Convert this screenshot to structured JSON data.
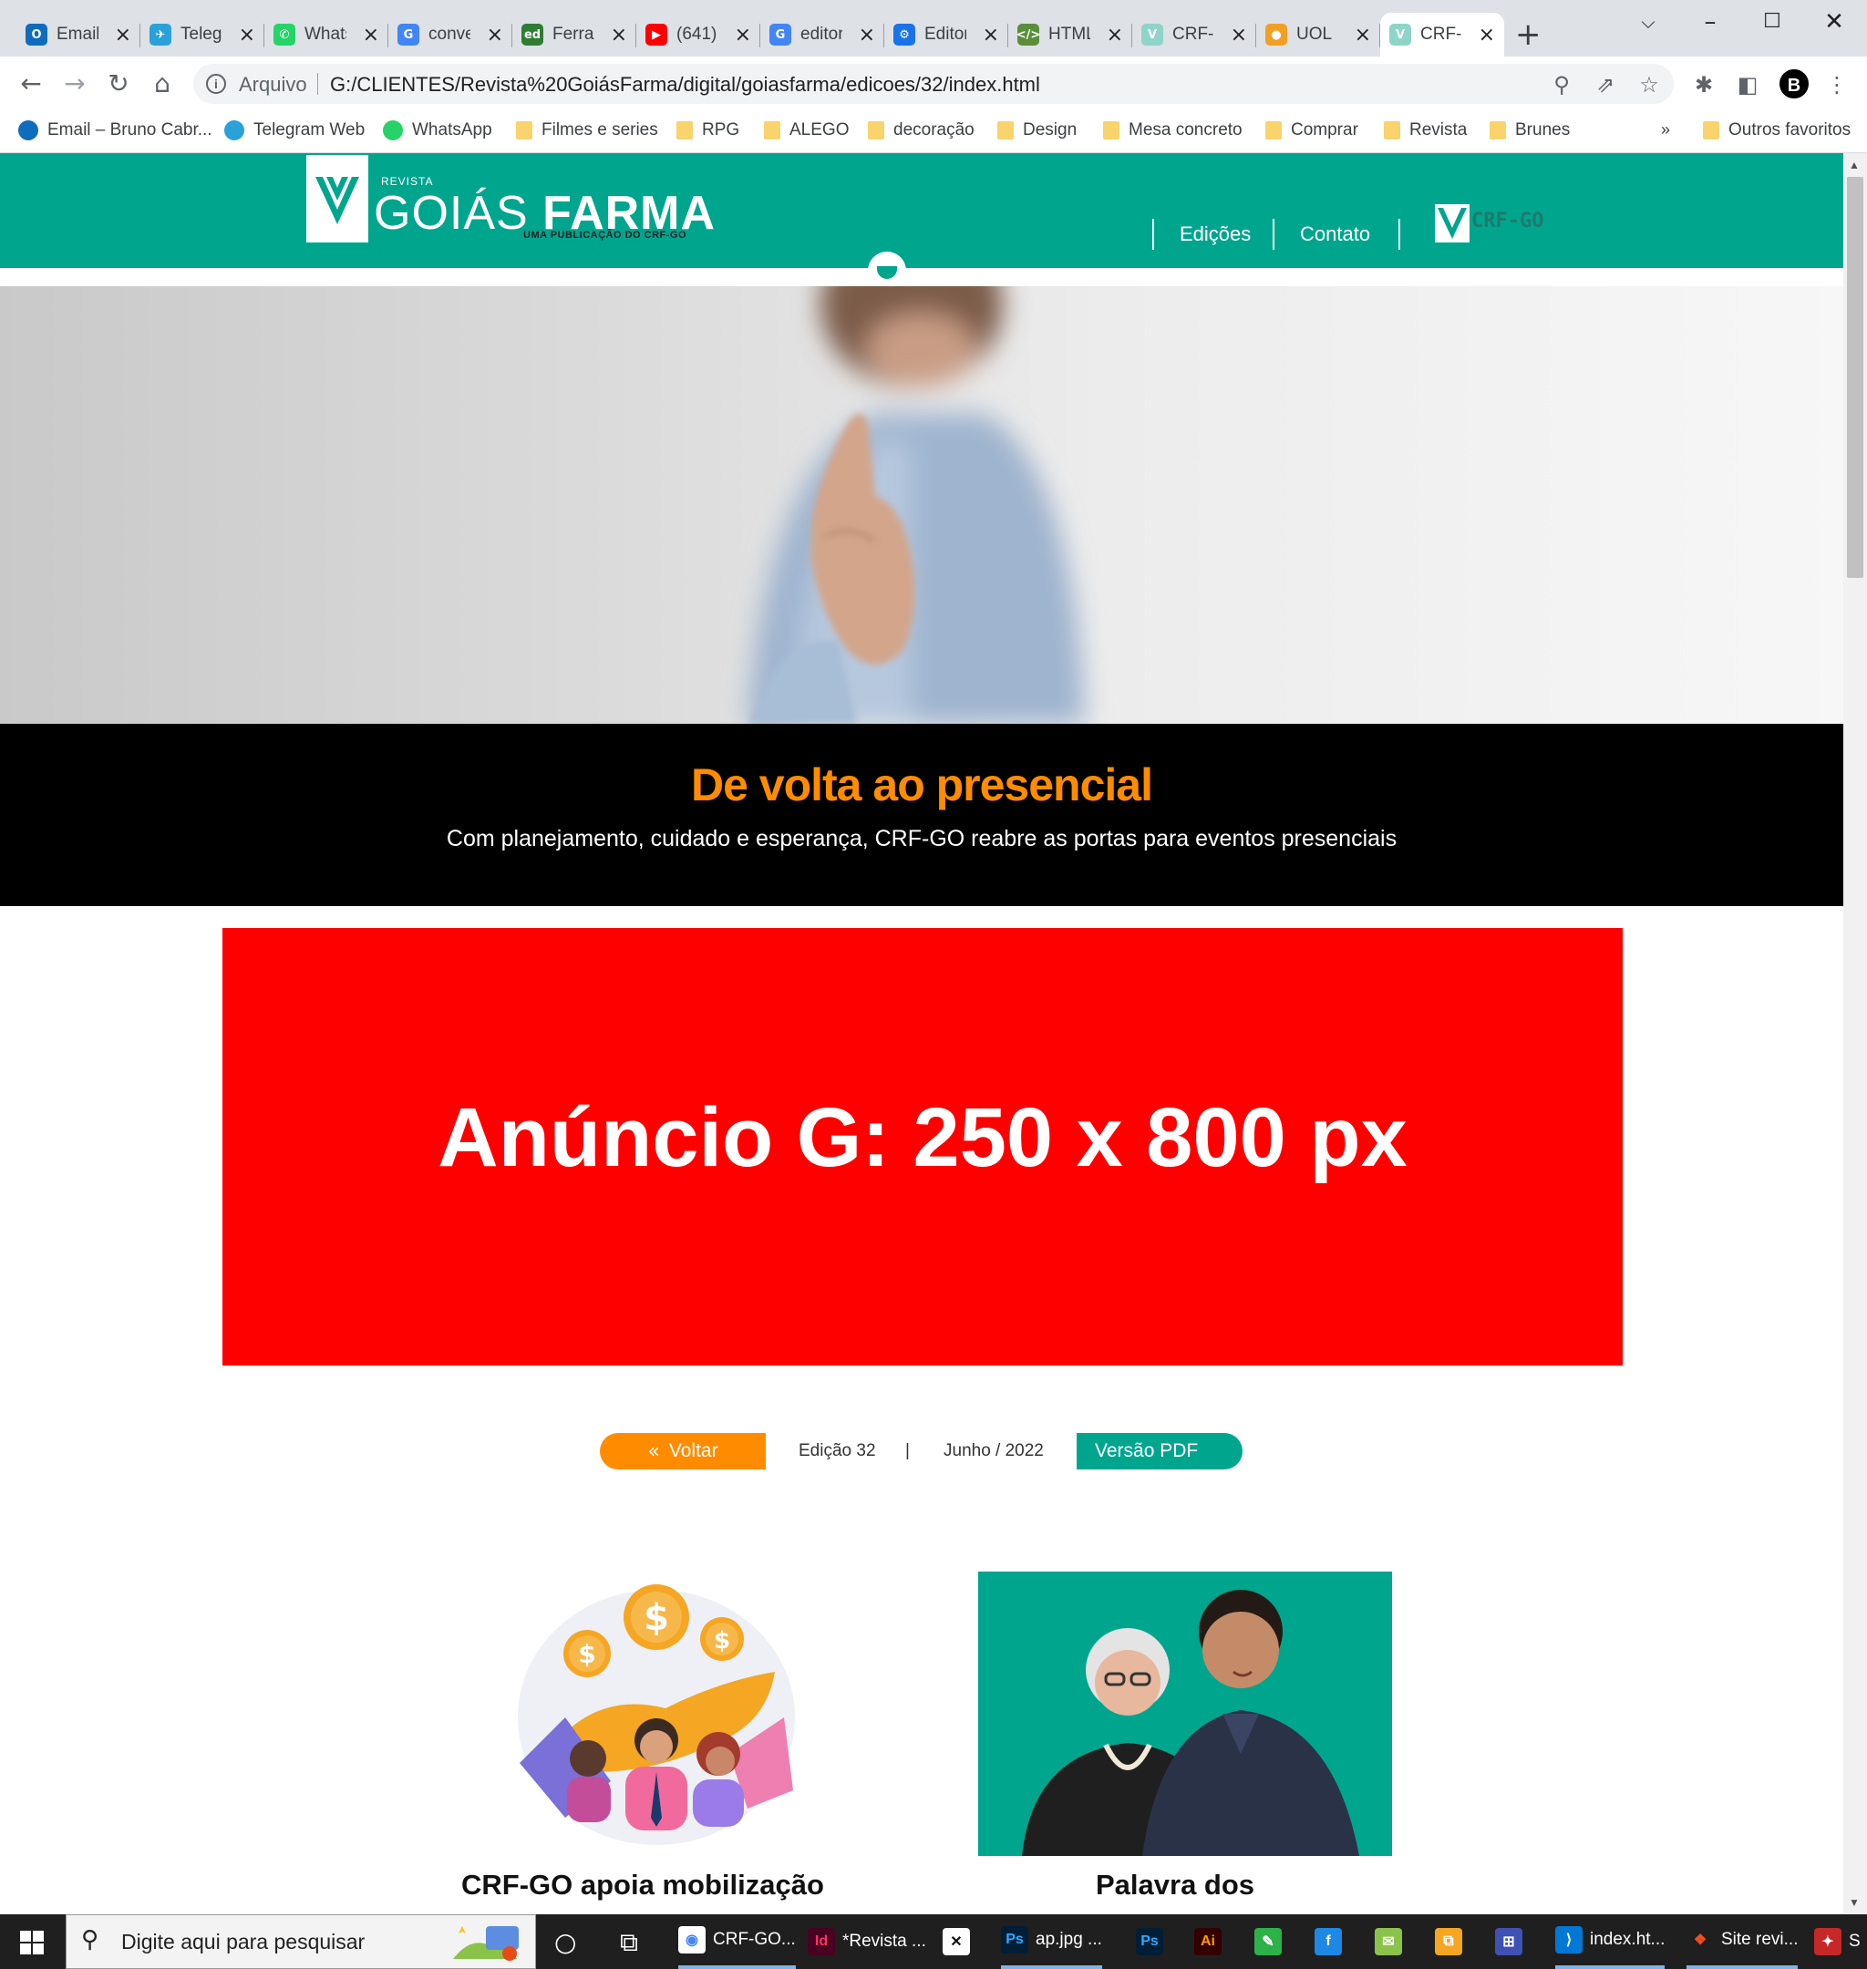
{
  "browser": {
    "tabs": [
      {
        "title": "Email – Bruno Cabral – Outlook",
        "icon": "outlook-icon",
        "color": "#0f6cbd",
        "letter": "O"
      },
      {
        "title": "Telegram Web",
        "icon": "telegram-icon",
        "color": "#2aa1db",
        "letter": "✈"
      },
      {
        "title": "WhatsApp",
        "icon": "whatsapp-icon",
        "color": "#25d366",
        "letter": "✆"
      },
      {
        "title": "conversor",
        "icon": "google-icon",
        "color": "#4285f4",
        "letter": "G"
      },
      {
        "title": "Ferramentas",
        "icon": "edit-icon",
        "color": "#2e7d32",
        "letter": "ed"
      },
      {
        "title": "(641)",
        "icon": "youtube-icon",
        "color": "#ff0000",
        "letter": "▶"
      },
      {
        "title": "editor",
        "icon": "google-icon",
        "color": "#4285f4",
        "letter": "G"
      },
      {
        "title": "Editor",
        "icon": "gear-icon",
        "color": "#1a73e8",
        "letter": "⚙"
      },
      {
        "title": "HTML",
        "icon": "code-icon",
        "color": "#5a8f3a",
        "letter": "</>"
      },
      {
        "title": "CRF-GO",
        "icon": "crf-icon",
        "color": "#8fd4c8",
        "letter": "V"
      },
      {
        "title": "UOL",
        "icon": "uol-icon",
        "color": "#f2a024",
        "letter": "●"
      },
      {
        "title": "CRF-GO",
        "icon": "crf-icon",
        "color": "#8fd4c8",
        "letter": "V"
      }
    ],
    "omnibox": {
      "scheme": "Arquivo",
      "url": "G:/CLIENTES/Revista%20GoiásFarma/digital/goiasfarma/edicoes/32/index.html"
    },
    "profile_letter": "B",
    "bookmarks": [
      {
        "label": "Email – Bruno Cabr...",
        "icon": "outlook-icon",
        "color": "#0f6cbd"
      },
      {
        "label": "Telegram Web",
        "icon": "telegram-icon",
        "color": "#2aa1db"
      },
      {
        "label": "WhatsApp",
        "icon": "whatsapp-icon",
        "color": "#25d366"
      },
      {
        "label": "Filmes e series",
        "icon": "folder-icon"
      },
      {
        "label": "RPG",
        "icon": "folder-icon"
      },
      {
        "label": "ALEGO",
        "icon": "folder-icon"
      },
      {
        "label": "decoração",
        "icon": "folder-icon"
      },
      {
        "label": "Design",
        "icon": "folder-icon"
      },
      {
        "label": "Mesa concreto",
        "icon": "folder-icon"
      },
      {
        "label": "Comprar",
        "icon": "folder-icon"
      },
      {
        "label": "Revista",
        "icon": "folder-icon"
      },
      {
        "label": "Brunes",
        "icon": "folder-icon"
      }
    ],
    "bookmarks_overflow": "»",
    "other_bookmarks": "Outros favoritos"
  },
  "site": {
    "logo": {
      "small": "REVISTA",
      "name_light": "GOIÁS",
      "name_bold": "FARMA",
      "sub": "UMA PUBLICAÇÃO DO CRF-GO"
    },
    "nav": [
      "Edições",
      "Contato"
    ],
    "crf_logo_text": "CRF-GO",
    "article": {
      "title": "De volta ao presencial",
      "subtitle": "Com planejamento, cuidado e esperança, CRF-GO reabre as portas para eventos presenciais"
    },
    "ad_label": "Anúncio G: 250 x 800 px",
    "meta": {
      "back_label": "Voltar",
      "edition": "Edição 32",
      "separator": "|",
      "date": "Junho / 2022",
      "pdf_label": "Versão PDF"
    },
    "cards": [
      {
        "title": "CRF-GO apoia mobilização"
      },
      {
        "title": "Palavra dos"
      }
    ],
    "colors": {
      "brand_green": "#00a58e",
      "accent_orange": "#ff8c00",
      "ad_red": "#ff0000"
    }
  },
  "taskbar": {
    "search_placeholder": "Digite aqui para pesquisar",
    "items": [
      {
        "label": "CRF-GO...",
        "icon": "chrome-icon",
        "bg": "#fff",
        "fg": "#4285f4",
        "glyph": "◉",
        "running": true
      },
      {
        "label": "*Revista ...",
        "icon": "indesign-icon",
        "bg": "#49021f",
        "fg": "#ff3366",
        "glyph": "Id",
        "running": false
      },
      {
        "label": "",
        "icon": "xbox-icon",
        "bg": "#fff",
        "fg": "#111",
        "glyph": "✕",
        "running": false
      },
      {
        "label": "ap.jpg ...",
        "icon": "photoshop-icon",
        "bg": "#001e36",
        "fg": "#31a8ff",
        "glyph": "Ps",
        "running": true
      },
      {
        "label": "",
        "icon": "photoshop-icon",
        "bg": "#001e36",
        "fg": "#31a8ff",
        "glyph": "Ps",
        "running": false
      },
      {
        "label": "",
        "icon": "illustrator-icon",
        "bg": "#330000",
        "fg": "#ff9a00",
        "glyph": "Ai",
        "running": false
      },
      {
        "label": "",
        "icon": "app-green-icon",
        "bg": "#2db24a",
        "fg": "#fff",
        "glyph": "✎",
        "running": false
      },
      {
        "label": "",
        "icon": "font-app-icon",
        "bg": "#1e88e5",
        "fg": "#fff",
        "glyph": "f",
        "running": false
      },
      {
        "label": "",
        "icon": "mail-icon",
        "bg": "#8bc34a",
        "fg": "#fff",
        "glyph": "✉",
        "running": false
      },
      {
        "label": "",
        "icon": "puzzle-icon",
        "bg": "#f5a623",
        "fg": "#fff",
        "glyph": "⧉",
        "running": false
      },
      {
        "label": "",
        "icon": "network-icon",
        "bg": "#3f51b5",
        "fg": "#fff",
        "glyph": "⊞",
        "running": false
      },
      {
        "label": "index.ht...",
        "icon": "vscode-icon",
        "bg": "#0078d4",
        "fg": "#fff",
        "glyph": "⟩",
        "running": true
      },
      {
        "label": "Site revi...",
        "icon": "figma-icon",
        "bg": "#1f1f1f",
        "fg": "#f24e1e",
        "glyph": "❖",
        "running": true
      },
      {
        "label": "S",
        "icon": "app-red-icon",
        "bg": "#c62828",
        "fg": "#fff",
        "glyph": "✦",
        "running": false
      }
    ]
  }
}
